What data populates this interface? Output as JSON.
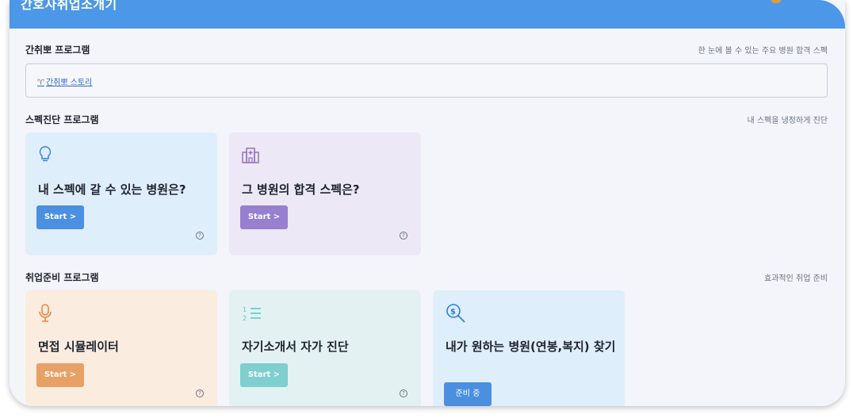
{
  "header": {
    "title": "간호사취업소개기"
  },
  "sections": {
    "story": {
      "title": "간취뽀 프로그램",
      "subtitle": "한 눈에 볼 수 있는 주요 병원 합격 스펙",
      "link_label": "간취뽀 스토리"
    },
    "diagnosis": {
      "title": "스펙진단 프로그램",
      "subtitle": "내 스펙을 냉정하게 진단",
      "cards": [
        {
          "title": "내 스펙에 갈 수 있는 병원은?",
          "button": "Start >",
          "help": "?"
        },
        {
          "title": "그 병원의 합격 스펙은?",
          "button": "Start >",
          "help": "?"
        }
      ]
    },
    "prep": {
      "title": "취업준비 프로그램",
      "subtitle": "효과적인 취업 준비",
      "cards": [
        {
          "title": "면접 시뮬레이터",
          "button": "Start >",
          "help": "?"
        },
        {
          "title": "자기소개서 자가 진단",
          "button": "Start >",
          "help": "?"
        },
        {
          "title": "내가 원하는 병원(연봉,복지) 찾기",
          "button": "준비 중"
        }
      ]
    }
  },
  "colors": {
    "header": "#4d97e8",
    "btn_blue": "#4a8fe0",
    "btn_purple": "#9680cf",
    "btn_orange": "#e7a065",
    "btn_teal": "#7fcfcf"
  }
}
